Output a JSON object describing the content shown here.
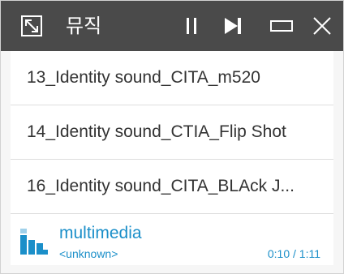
{
  "header": {
    "title": "뮤직"
  },
  "playlist": [
    {
      "label": "13_Identity sound_CITA_m520"
    },
    {
      "label": "14_Identity sound_CTIA_Flip Shot"
    },
    {
      "label": "16_Identity sound_CITA_BLAck J..."
    }
  ],
  "now_playing": {
    "title": "multimedia",
    "artist": "<unknown>",
    "time": "0:10 / 1:11"
  },
  "colors": {
    "accent": "#1b8fc9",
    "titlebar": "#4a4a4a"
  },
  "icons": [
    "expand-icon",
    "pause-icon",
    "next-icon",
    "minimize-icon",
    "close-icon",
    "equalizer-icon"
  ]
}
